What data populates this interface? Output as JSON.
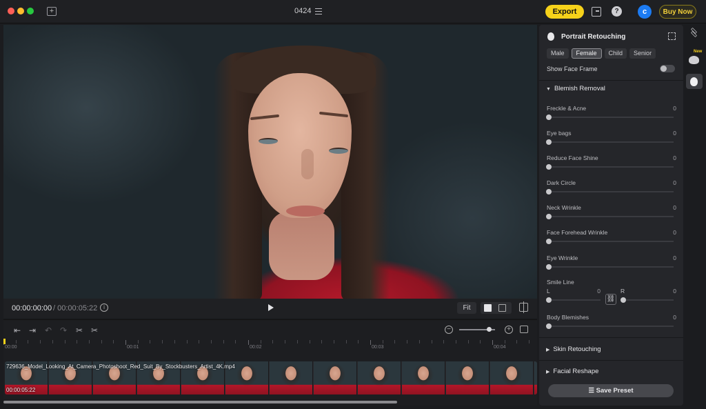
{
  "window": {
    "title": "0424"
  },
  "header": {
    "export_label": "Export",
    "buy_label": "Buy Now",
    "avatar_letter": "c"
  },
  "preview": {
    "time_current": "00:00:00:00",
    "time_total": "/ 00:00:05:22",
    "fit_label": "Fit"
  },
  "timeline": {
    "ruler_labels": [
      "00:00",
      "00:01",
      "00:02",
      "00:03",
      "00:04"
    ],
    "clip_name": "729636_Model_Looking_At_Camera_Photoshoot_Red_Suit_By_Stockbusters_Artist_4K.mp4",
    "clip_duration": "00:00:05:22"
  },
  "panel": {
    "title": "Portrait Retouching",
    "gender_tabs": [
      "Male",
      "Female",
      "Child",
      "Senior"
    ],
    "gender_selected": "Female",
    "face_frame_label": "Show Face Frame",
    "blemish": {
      "title": "Blemish Removal",
      "sliders": [
        {
          "label": "Freckle & Acne",
          "value": "0"
        },
        {
          "label": "Eye bags",
          "value": "0"
        },
        {
          "label": "Reduce Face Shine",
          "value": "0"
        },
        {
          "label": "Dark Circle",
          "value": "0"
        },
        {
          "label": "Neck Wrinkle",
          "value": "0"
        },
        {
          "label": "Face Forehead Wrinkle",
          "value": "0"
        },
        {
          "label": "Eye Wrinkle",
          "value": "0"
        }
      ],
      "smile": {
        "label": "Smile Line",
        "left_label": "L",
        "left_value": "0",
        "right_label": "R",
        "right_value": "0"
      },
      "body": {
        "label": "Body Blemishes",
        "value": "0"
      }
    },
    "skin_title": "Skin Retouching",
    "reshape_title": "Facial Reshape",
    "save_preset_label": "Save Preset"
  },
  "rail": {
    "new_badge": "New"
  },
  "colors": {
    "accent": "#f6d21a",
    "avatar": "#1c7bf2",
    "dress": "#b3192a"
  }
}
